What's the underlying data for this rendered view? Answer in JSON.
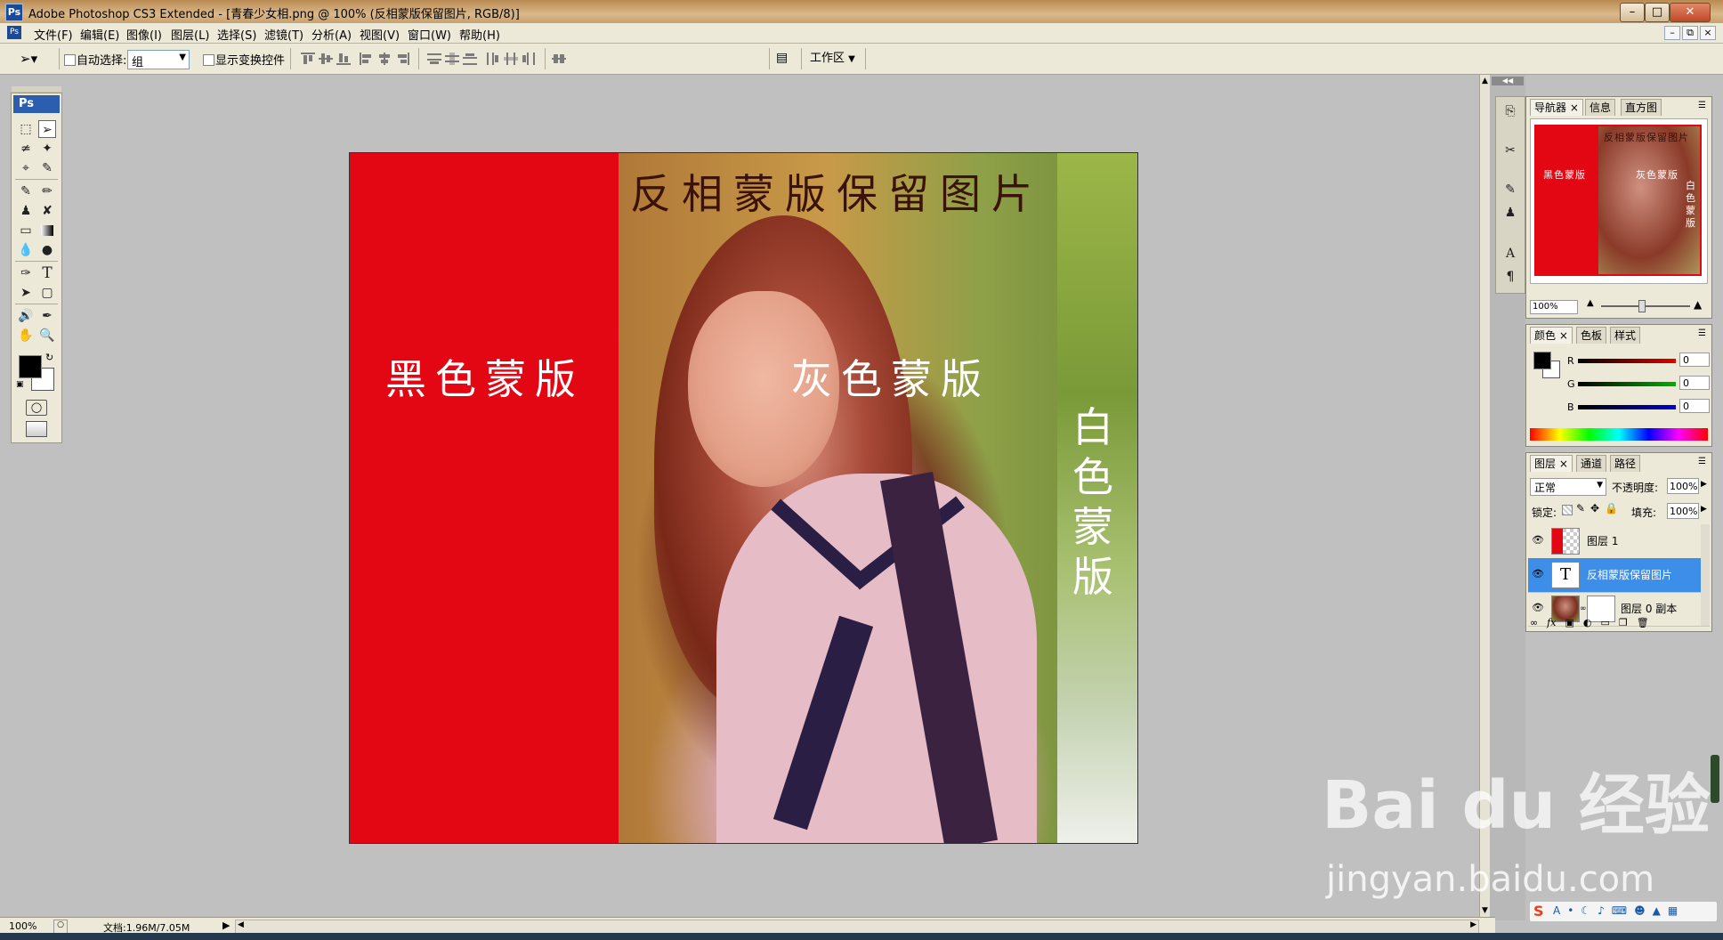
{
  "window": {
    "title": "Adobe Photoshop CS3 Extended - [青春少女相.png @ 100% (反相蒙版保留图片, RGB/8)]",
    "app_icon": "Ps"
  },
  "menu": [
    "文件(F)",
    "编辑(E)",
    "图像(I)",
    "图层(L)",
    "选择(S)",
    "滤镜(T)",
    "分析(A)",
    "视图(V)",
    "窗口(W)",
    "帮助(H)"
  ],
  "options_bar": {
    "auto_select_label": "自动选择:",
    "auto_select_value": "组",
    "show_transform_label": "显示变换控件",
    "workspace_label": "工作区"
  },
  "toolbox": {
    "header": "Ps",
    "tools": [
      "marquee-icon",
      "move-icon",
      "lasso-icon",
      "magic-wand-icon",
      "crop-icon",
      "slice-icon",
      "healing-brush-icon",
      "brush-icon",
      "clone-stamp-icon",
      "history-brush-icon",
      "eraser-icon",
      "gradient-icon",
      "blur-icon",
      "dodge-icon",
      "pen-icon",
      "type-icon",
      "path-select-icon",
      "shape-icon",
      "notes-icon",
      "eyedropper-icon",
      "hand-icon",
      "zoom-icon"
    ],
    "type_glyph": "T"
  },
  "canvas": {
    "title_text": "反相蒙版保留图片",
    "black_mask_label": "黑色蒙版",
    "gray_mask_label": "灰色蒙版",
    "white_mask_chars": [
      "白",
      "色",
      "蒙",
      "版"
    ],
    "accent_color": "#e30613"
  },
  "navigator_panel": {
    "tabs": [
      "导航器",
      "信息",
      "直方图"
    ],
    "zoom": "100%",
    "thumb_black": "黑色蒙版",
    "thumb_gray": "灰色蒙版",
    "thumb_title": "反相蒙版保留图片",
    "thumb_white_chars": [
      "白",
      "色",
      "蒙",
      "版"
    ]
  },
  "color_panel": {
    "tabs": [
      "颜色",
      "色板",
      "样式"
    ],
    "channels": [
      {
        "label": "R",
        "value": "0",
        "color": "#e00000"
      },
      {
        "label": "G",
        "value": "0",
        "color": "#00b000"
      },
      {
        "label": "B",
        "value": "0",
        "color": "#0000d0"
      }
    ]
  },
  "layers_panel": {
    "tabs": [
      "图层",
      "通道",
      "路径"
    ],
    "blend_mode": "正常",
    "opacity_label": "不透明度:",
    "opacity_value": "100%",
    "lock_label": "锁定:",
    "fill_label": "填充:",
    "fill_value": "100%",
    "layers": [
      {
        "name": "图层 1",
        "type": "raster",
        "selected": false
      },
      {
        "name": "反相蒙版保留图片",
        "type": "text",
        "selected": true,
        "thumb_glyph": "T"
      },
      {
        "name": "图层 0 副本",
        "type": "masked",
        "selected": false
      }
    ]
  },
  "status_bar": {
    "zoom": "100%",
    "doc_info": "文档:1.96M/7.05M"
  },
  "watermark": {
    "brand": "Bai du 经验",
    "url": "jingyan.baidu.com"
  }
}
